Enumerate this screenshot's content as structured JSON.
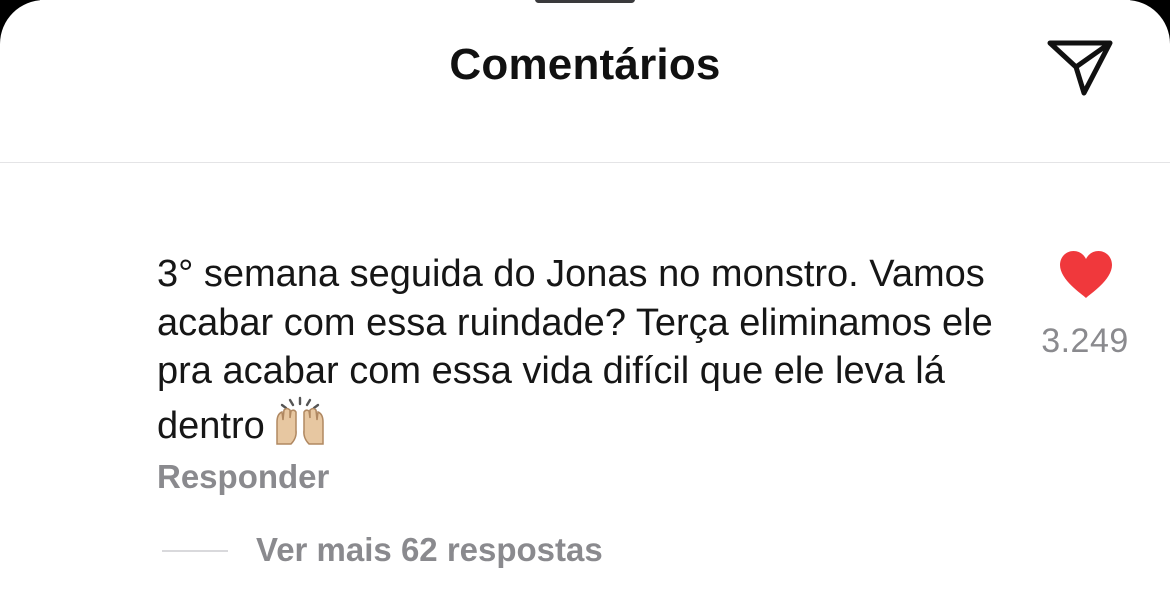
{
  "header": {
    "title": "Comentários",
    "share_icon": "send-icon"
  },
  "comment": {
    "text": "3° semana seguida do Jonas no monstro. Vamos acabar com essa ruindade? Terça eliminamos ele pra acabar com essa vida difícil que ele leva lá dentro",
    "emoji_icon": "raising-hands-emoji-icon",
    "reply_label": "Responder",
    "likes": "3.249",
    "liked": true,
    "like_color": "#f0383c"
  },
  "replies": {
    "more_label": "Ver mais 62 respostas"
  }
}
